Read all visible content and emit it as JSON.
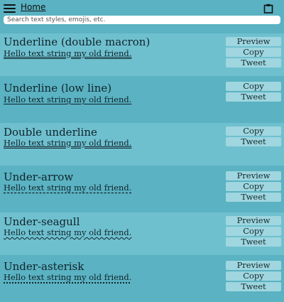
{
  "header": {
    "home_label": "Home",
    "search_placeholder": "Search text styles, emojis, etc."
  },
  "cards": [
    {
      "title": "Underline (double macron)",
      "sample": "Hello text string my old friend.",
      "buttons": [
        "Preview",
        "Copy",
        "Tweet"
      ]
    },
    {
      "title": "Underline (low line)",
      "sample": "Hello text string my old friend.",
      "buttons": [
        "Copy",
        "Tweet"
      ]
    },
    {
      "title": "Double underline",
      "sample": "Hello text string my old friend.",
      "buttons": [
        "Copy",
        "Tweet"
      ]
    },
    {
      "title": "Under-arrow",
      "sample": "Hello text string my old friend.",
      "buttons": [
        "Preview",
        "Copy",
        "Tweet"
      ]
    },
    {
      "title": "Under-seagull",
      "sample": "Hello text string my old friend.",
      "buttons": [
        "Preview",
        "Copy",
        "Tweet"
      ]
    },
    {
      "title": "Under-asterisk",
      "sample": "Hello text string my old friend.",
      "buttons": [
        "Preview",
        "Copy",
        "Tweet"
      ]
    }
  ],
  "colors": {
    "background": "#5ab2c2",
    "card_alt": "#6fc0cf",
    "button": "#9fd6df"
  }
}
